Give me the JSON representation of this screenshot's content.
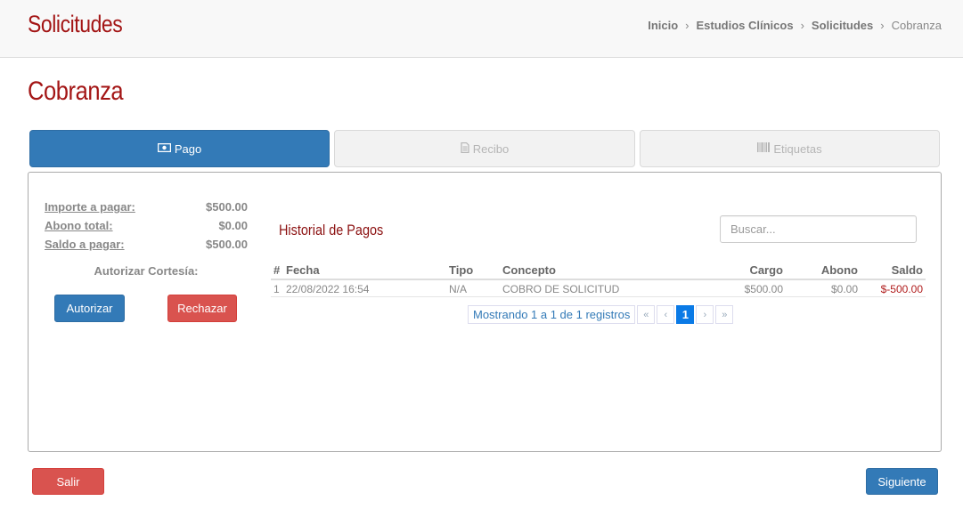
{
  "header": {
    "app_title": "Solicitudes",
    "breadcrumb": [
      "Inicio",
      "Estudios Clínicos",
      "Solicitudes",
      "Cobranza"
    ]
  },
  "page_title": "Cobranza",
  "tabs": [
    {
      "label": "Pago",
      "icon": "money-icon",
      "state": "active"
    },
    {
      "label": "Recibo",
      "icon": "document-icon",
      "state": "disabled"
    },
    {
      "label": "Etiquetas",
      "icon": "barcode-icon",
      "state": "disabled"
    }
  ],
  "summary": {
    "importe_label": "Importe a pagar:",
    "importe_value": "$500.00",
    "abono_label": "Abono total:",
    "abono_value": "$0.00",
    "saldo_label": "Saldo a pagar:",
    "saldo_value": "$500.00"
  },
  "cortesia": {
    "label": "Autorizar Cortesía:",
    "authorize_label": "Autorizar",
    "reject_label": "Rechazar"
  },
  "historial": {
    "title": "Historial de Pagos",
    "search_placeholder": "Buscar...",
    "columns": [
      "#",
      "Fecha",
      "Tipo",
      "Concepto",
      "Cargo",
      "Abono",
      "Saldo"
    ],
    "rows": [
      {
        "num": "1",
        "fecha": "22/08/2022 16:54",
        "tipo": "N/A",
        "concepto": "COBRO DE SOLICITUD",
        "cargo": "$500.00",
        "abono": "$0.00",
        "saldo": "$-500.00"
      }
    ],
    "pagination_info": "Mostrando 1 a 1 de 1 registros",
    "pages": {
      "first": "«",
      "prev": "‹",
      "current": "1",
      "next": "›",
      "last": "»"
    }
  },
  "footer": {
    "exit_label": "Salir",
    "next_label": "Siguiente"
  },
  "colors": {
    "brand_red": "#a31515",
    "primary_blue": "#337ab7",
    "danger_red": "#d9534f",
    "negative_balance": "#b01c1c"
  }
}
